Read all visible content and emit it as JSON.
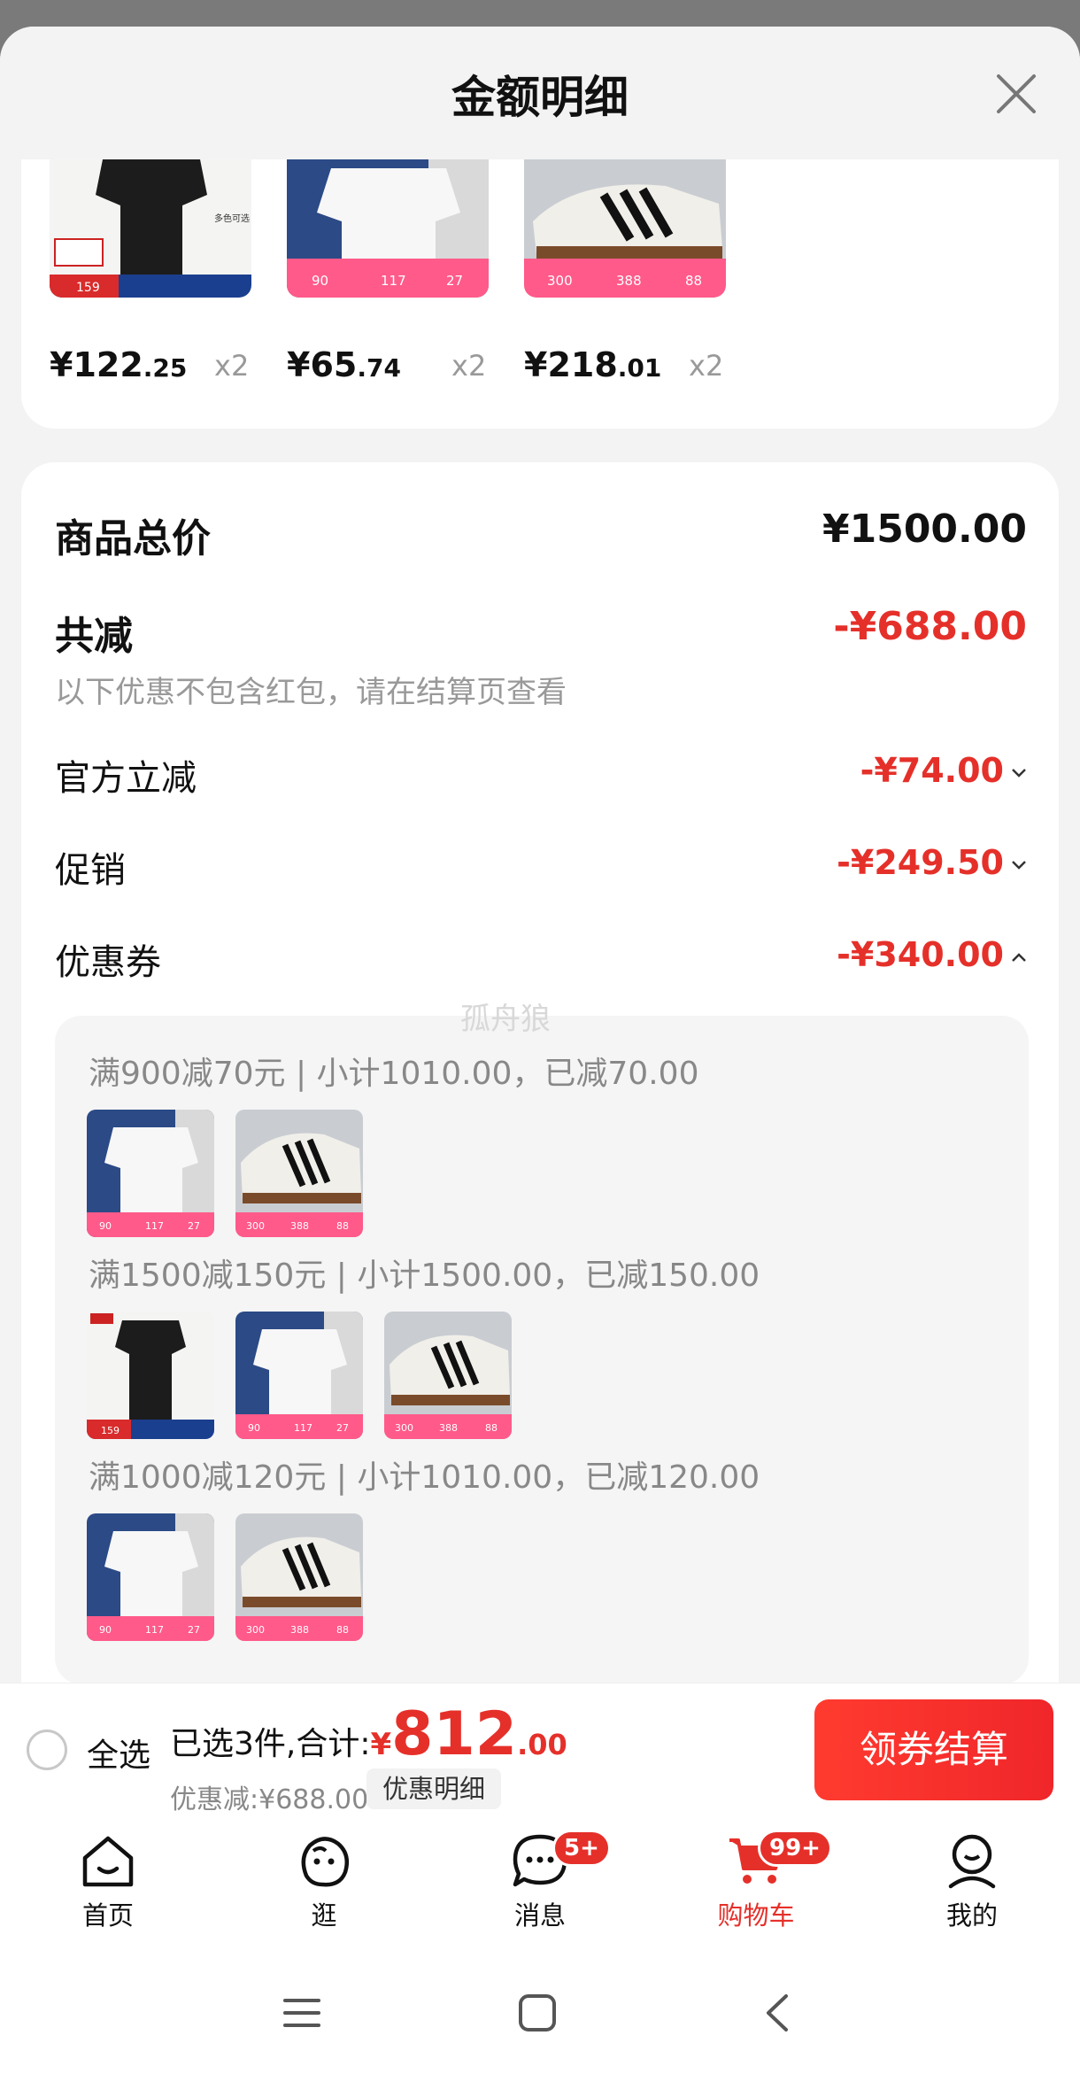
{
  "sheet": {
    "title": "金额明细"
  },
  "products": [
    {
      "price_int": "¥122",
      "price_dec": ".25",
      "qty": "x2",
      "image": "black-polo-shirt"
    },
    {
      "price_int": "¥65",
      "price_dec": ".74",
      "qty": "x2",
      "image": "white-tshirt"
    },
    {
      "price_int": "¥218",
      "price_dec": ".01",
      "qty": "x2",
      "image": "white-sneakers"
    }
  ],
  "summary": {
    "total_label": "商品总价",
    "total_value": "¥1500.00",
    "reduce_label": "共减",
    "reduce_value": "-¥688.00",
    "reduce_note": "以下优惠不包含红包，请在结算页查看",
    "items": [
      {
        "label": "官方立减",
        "value": "-¥74.00",
        "expanded": false
      },
      {
        "label": "促销",
        "value": "-¥249.50",
        "expanded": false
      },
      {
        "label": "优惠券",
        "value": "-¥340.00",
        "expanded": true
      }
    ]
  },
  "coupons": [
    {
      "text": "满900减70元 | 小计1010.00，已减70.00",
      "thumbs": [
        "white-tshirt",
        "white-sneakers"
      ]
    },
    {
      "text": "满1500减150元 | 小计1500.00，已减150.00",
      "thumbs": [
        "black-polo-shirt",
        "white-tshirt",
        "white-sneakers"
      ]
    },
    {
      "text": "满1000减120元 | 小计1010.00，已减120.00",
      "thumbs": [
        "white-tshirt",
        "white-sneakers"
      ]
    }
  ],
  "watermark": "孤舟狼",
  "bottom_bar": {
    "select_all": "全选",
    "selected_text": "已选3件,合计:",
    "yen": "¥",
    "total_int": "812",
    "total_dec": ".00",
    "discount_text": "优惠减:¥688.00",
    "detail_button": "优惠明细",
    "checkout_button": "领券结算"
  },
  "tabbar": {
    "items": [
      {
        "label": "首页",
        "icon": "home-icon"
      },
      {
        "label": "逛",
        "icon": "browse-face-icon"
      },
      {
        "label": "消息",
        "icon": "message-icon",
        "badge": "5+"
      },
      {
        "label": "购物车",
        "icon": "cart-icon",
        "badge": "99+",
        "active": true
      },
      {
        "label": "我的",
        "icon": "profile-icon"
      }
    ]
  },
  "colors": {
    "accent": "#e5302a",
    "background": "#f3f3f3"
  }
}
